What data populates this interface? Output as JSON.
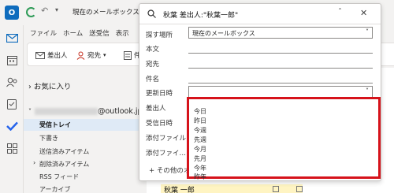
{
  "topbar": {
    "location_select": "現在のメールボックス",
    "search_query": "秋葉 差出人:\"秋葉一郎\""
  },
  "menubar": [
    "ファイル",
    "ホーム",
    "送受信",
    "表示"
  ],
  "ribbon": {
    "from_label": "差出人",
    "to_label": "宛先",
    "partial_label": "件"
  },
  "folders": {
    "favorites": "お気に入り",
    "account": "@outlook.jp",
    "items": [
      "受信トレイ",
      "下書き",
      "送信済みアイテム",
      "削除済みアイテム",
      "RSS フィード",
      "アーカイブ"
    ]
  },
  "search_form": {
    "scope_label": "探す場所",
    "scope_value": "現在のメールボックス",
    "body_label": "本文",
    "to_label": "宛先",
    "subject_label": "件名",
    "updated_label": "更新日時",
    "from_label": "差出人",
    "received_label": "受信日時",
    "attach_label": "添付ファイル",
    "attach2_label": "添付ファイ…",
    "more_label": "その他のオ"
  },
  "date_options": [
    "今日",
    "昨日",
    "今週",
    "先週",
    "今月",
    "先月",
    "今年",
    "昨年"
  ],
  "mail_preview": {
    "sender": "秋葉 一郎"
  },
  "colors": {
    "accent": "#0f6cbd",
    "highlight": "#d6131b",
    "selected": "#dfeaf6"
  }
}
